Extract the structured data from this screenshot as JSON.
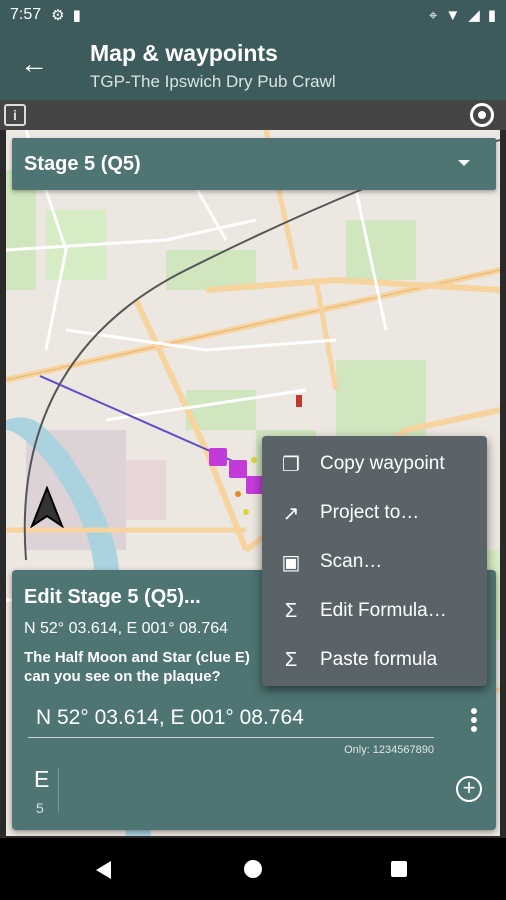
{
  "status_bar": {
    "time": "7:57",
    "icons": [
      "gear-icon",
      "sd-card-icon",
      "location-icon",
      "wifi-icon",
      "signal-icon",
      "battery-icon"
    ]
  },
  "app_bar": {
    "title": "Map & waypoints",
    "subtitle": "TGP-The Ipswich Dry Pub Crawl"
  },
  "toolbar": {
    "info_label": "i"
  },
  "stage_selector": {
    "selected": "Stage 5 (Q5)"
  },
  "edit_panel": {
    "title": "Edit Stage 5 (Q5)...",
    "coords": "N 52° 03.614, E 001° 08.764",
    "description": "The Half Moon and Star (clue E) can you see on the plaque?",
    "coord_value": "N 52° 03.614, E 001° 08.764",
    "hint": "Only: 1234567890",
    "variable_letter": "E",
    "variable_value": "5"
  },
  "context_menu": {
    "items": [
      {
        "label": "Copy waypoint",
        "icon": "copy-icon"
      },
      {
        "label": "Project to…",
        "icon": "trending-icon"
      },
      {
        "label": "Scan…",
        "icon": "scan-icon"
      },
      {
        "label": "Edit Formula…",
        "icon": "sigma-icon"
      },
      {
        "label": "Paste formula",
        "icon": "sigma-icon"
      }
    ]
  },
  "colors": {
    "accent": "#3d5b5c",
    "panel": "#4e7474",
    "menu": "#5a6468",
    "route": "#5b4ec9",
    "waypoint": "#c23bd9"
  }
}
